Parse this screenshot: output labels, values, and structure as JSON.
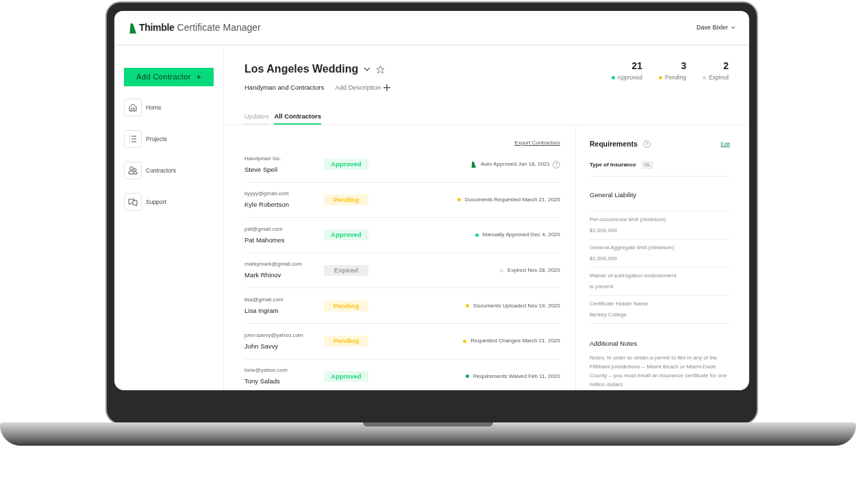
{
  "app": {
    "brand": "Thimble",
    "title": "Certificate Manager",
    "user": "Dave Bixler"
  },
  "sidebar": {
    "add_button": "Add Contractor",
    "add_icon": "+",
    "items": [
      {
        "label": "Home"
      },
      {
        "label": "Projects"
      },
      {
        "label": "Contractors"
      },
      {
        "label": "Support"
      }
    ]
  },
  "project": {
    "title": "Los Angeles Wedding",
    "subtitle": "Handyman and Contractors",
    "add_description": "Add Description"
  },
  "stats": [
    {
      "count": "21",
      "label": "Approved",
      "color": "#1fd67c"
    },
    {
      "count": "3",
      "label": "Pending",
      "color": "#fcc419"
    },
    {
      "count": "2",
      "label": "Expired",
      "color": "#d9d9d9"
    }
  ],
  "tabs": [
    {
      "label": "Updates",
      "selected": false
    },
    {
      "label": "All Contractors",
      "selected": true
    }
  ],
  "export_link": "Export Contractors",
  "contractors": [
    {
      "email": "Handyman Inc.",
      "name": "Steve Speil",
      "status": "Approved",
      "kind": "approved",
      "note": "Auto Approved Jan 18, 2021",
      "help": true
    },
    {
      "email": "kyyyy@gmail.com",
      "name": "Kyle Robertson",
      "status": "Pending",
      "kind": "pending",
      "note": "Documents Requested March 21, 2020",
      "color": "#fcc419",
      "help": false
    },
    {
      "email": "pat@gmail.com",
      "name": "Pat Mahomes",
      "status": "Approved",
      "kind": "approved",
      "note": "Manually Approved Dec 4, 2020",
      "color": "#1fd67c",
      "help": false
    },
    {
      "email": "markymark@gmail.com",
      "name": "Mark Rhinov",
      "status": "Expired",
      "kind": "expired",
      "note": "Expired Nov 28, 2020",
      "color": "#dddddd",
      "help": false
    },
    {
      "email": "lisa@gmail.com",
      "name": "Lisa Ingram",
      "status": "Pending",
      "kind": "pending",
      "note": "Documents Uploaded Nov 19, 2020",
      "color": "#fcc419",
      "help": false
    },
    {
      "email": "john-savvy@yahoo.com",
      "name": "John Savvy",
      "status": "Pending",
      "kind": "pending",
      "note": "Requested Changes March 21, 2020",
      "color": "#fcc419",
      "help": false
    },
    {
      "email": "tone@yahoo.com",
      "name": "Tony Salads",
      "status": "Approved",
      "kind": "approved",
      "note": "Requirements Waived Feb 11, 2020",
      "color": "#0fa87a",
      "help": false
    }
  ],
  "requirements": {
    "title": "Requirements",
    "edit": "Edit",
    "type_label": "Type of Insurance",
    "type_value": "GL",
    "section": "General Liability",
    "items": [
      {
        "label": "Per-occurrence limit (minimum)",
        "value": "$1,000,000"
      },
      {
        "label": "General Aggregate limit (minimum)",
        "value": "$1,000,000"
      },
      {
        "label": "Waiver of subrogation endorsement",
        "value": "is present"
      },
      {
        "label": "Certificate Holder Name",
        "value": "Berkey College"
      }
    ],
    "notes_title": "Additional Notes",
    "notes": "Notes: In order to obtain a permit to film in any of the FilMiami jurisdictions -- Miami Beach or Miami-Dade County -- you must email an insurance certificate for one million dollars"
  }
}
